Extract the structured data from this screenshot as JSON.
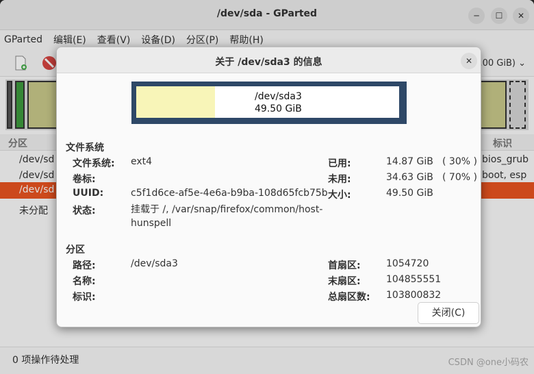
{
  "window": {
    "title": "/dev/sda - GParted",
    "menu": [
      "GParted",
      "编辑(E)",
      "查看(V)",
      "设备(D)",
      "分区(P)",
      "帮助(H)"
    ],
    "device_selector": ".00 GiB)"
  },
  "partition_list": {
    "headers": {
      "partition": "分区",
      "flags": "标识"
    },
    "rows": [
      {
        "name": "/dev/sd",
        "flags": "bios_grub",
        "selected": false
      },
      {
        "name": "/dev/sd",
        "flags": "boot, esp",
        "selected": false
      },
      {
        "name": "/dev/sd",
        "flags": "",
        "selected": true
      },
      {
        "name": "未分配",
        "flags": "",
        "selected": false
      }
    ]
  },
  "statusbar": {
    "text": "0 项操作待处理"
  },
  "watermark": "CSDN @one小码农",
  "dialog": {
    "title": "关于 /dev/sda3 的信息",
    "close_label": "关闭(C)",
    "usage_bar": {
      "name": "/dev/sda3",
      "size": "49.50 GiB",
      "used_fraction": 0.3
    },
    "filesystem": {
      "section_title": "文件系统",
      "fs_label": "文件系统:",
      "fs_value": "ext4",
      "volume_label": "卷标:",
      "volume_value": "",
      "uuid_label": "UUID:",
      "uuid_value": "c5f1d6ce-af5e-4e6a-b9ba-108d65fcb75b",
      "status_label": "状态:",
      "status_value": "挂载于 /, /var/snap/firefox/common/host-hunspell",
      "used_label": "已用:",
      "used_value": "14.87 GiB",
      "used_pct": "( 30% )",
      "unused_label": "未用:",
      "unused_value": "34.63 GiB",
      "unused_pct": "( 70% )",
      "size_label": "大小:",
      "size_value": "49.50 GiB"
    },
    "partition": {
      "section_title": "分区",
      "path_label": "路径:",
      "path_value": "/dev/sda3",
      "name_label": "名称:",
      "name_value": "",
      "flags_label": "标识:",
      "flags_value": "",
      "first_sector_label": "首扇区:",
      "first_sector_value": "1054720",
      "last_sector_label": "末扇区:",
      "last_sector_value": "104855551",
      "total_sectors_label": "总扇区数:",
      "total_sectors_value": "103800832"
    }
  },
  "colors": {
    "accent": "#e95420",
    "bar_border": "#2e4867",
    "used_fill": "#f8f5b8"
  }
}
